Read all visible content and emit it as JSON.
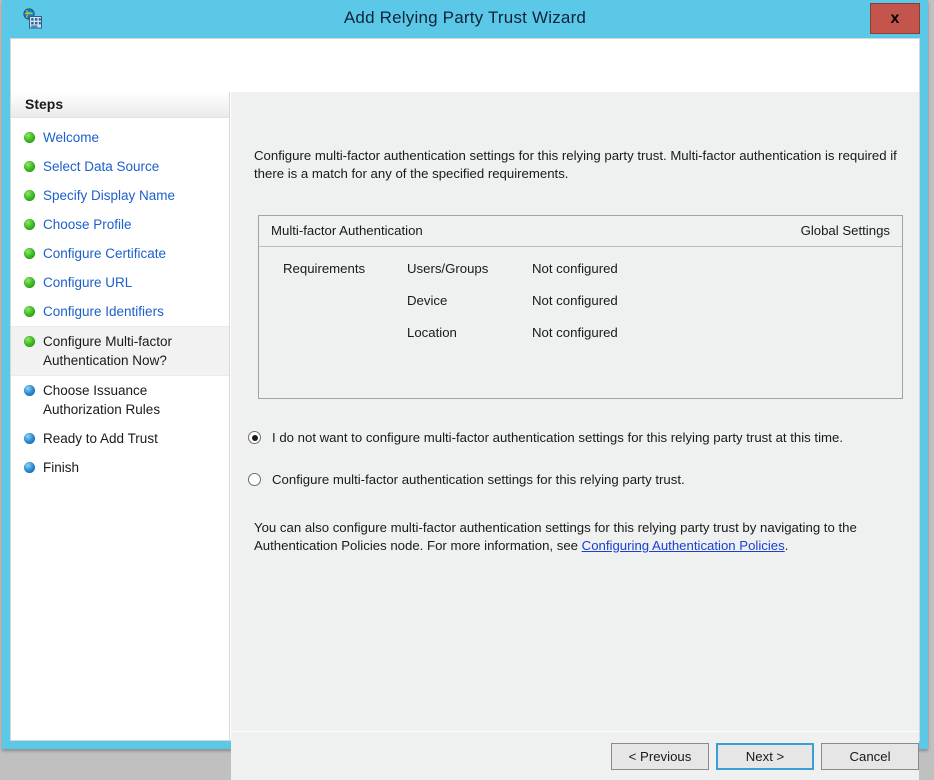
{
  "window": {
    "title": "Add Relying Party Trust Wizard",
    "icon": "adfs-relying-party-icon",
    "close_label": "x",
    "accent_color": "#5bc8e8",
    "close_color": "#c4554d"
  },
  "sidebar": {
    "header": "Steps",
    "items": [
      {
        "label": "Welcome",
        "state": "done"
      },
      {
        "label": "Select Data Source",
        "state": "done"
      },
      {
        "label": "Specify Display Name",
        "state": "done"
      },
      {
        "label": "Choose Profile",
        "state": "done"
      },
      {
        "label": "Configure Certificate",
        "state": "done"
      },
      {
        "label": "Configure URL",
        "state": "done"
      },
      {
        "label": "Configure Identifiers",
        "state": "done"
      },
      {
        "label": "Configure Multi-factor Authentication Now?",
        "state": "current"
      },
      {
        "label": "Choose Issuance Authorization Rules",
        "state": "pending"
      },
      {
        "label": "Ready to Add Trust",
        "state": "pending"
      },
      {
        "label": "Finish",
        "state": "pending"
      }
    ]
  },
  "content": {
    "intro": "Configure multi-factor authentication settings for this relying party trust. Multi-factor authentication is required if there is a match for any of the specified requirements.",
    "panel": {
      "title": "Multi-factor Authentication",
      "scope": "Global Settings",
      "section_label": "Requirements",
      "rows": [
        {
          "name": "Users/Groups",
          "value": "Not configured"
        },
        {
          "name": "Device",
          "value": "Not configured"
        },
        {
          "name": "Location",
          "value": "Not configured"
        }
      ]
    },
    "options": [
      {
        "label": "I do not want to configure multi-factor authentication settings for this relying party trust at this time.",
        "selected": true
      },
      {
        "label": "Configure multi-factor authentication settings for this relying party trust.",
        "selected": false
      }
    ],
    "footnote": {
      "text_before": "You can also configure multi-factor authentication settings for this relying party trust by navigating to the Authentication Policies node. For more information, see ",
      "link_text": "Configuring Authentication Policies",
      "text_after": "."
    }
  },
  "buttons": {
    "previous": "< Previous",
    "next": "Next >",
    "cancel": "Cancel"
  }
}
